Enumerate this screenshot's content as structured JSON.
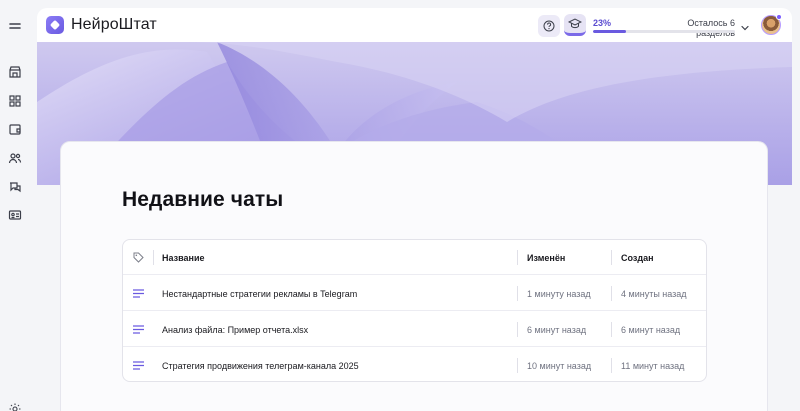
{
  "app": {
    "brand": "НейроШтат"
  },
  "header": {
    "progress_percent": 23,
    "progress_label": "23%",
    "remaining_label": "Осталось 6 разделов"
  },
  "sidebar": {
    "items": [
      {
        "icon": "menu-icon"
      },
      {
        "icon": "store-icon"
      },
      {
        "icon": "dashboard-icon"
      },
      {
        "icon": "wallet-icon"
      },
      {
        "icon": "users-icon"
      },
      {
        "icon": "chat-icon"
      },
      {
        "icon": "id-card-icon"
      },
      {
        "icon": "sun-icon"
      }
    ]
  },
  "main": {
    "title": "Недавние чаты",
    "table": {
      "columns": {
        "name": "Название",
        "modified": "Изменён",
        "created": "Создан"
      },
      "rows": [
        {
          "name": "Нестандартные стратегии рекламы в Telegram",
          "modified": "1 минуту назад",
          "created": "4 минуты назад"
        },
        {
          "name": "Анализ файла: Пример отчета.xlsx",
          "modified": "6 минут назад",
          "created": "6 минут назад"
        },
        {
          "name": "Стратегия продвижения телеграм-канала 2025",
          "modified": "10 минут назад",
          "created": "11 минут назад"
        }
      ]
    }
  },
  "colors": {
    "accent": "#6a5ae0",
    "banner": "#b8b0ea"
  }
}
